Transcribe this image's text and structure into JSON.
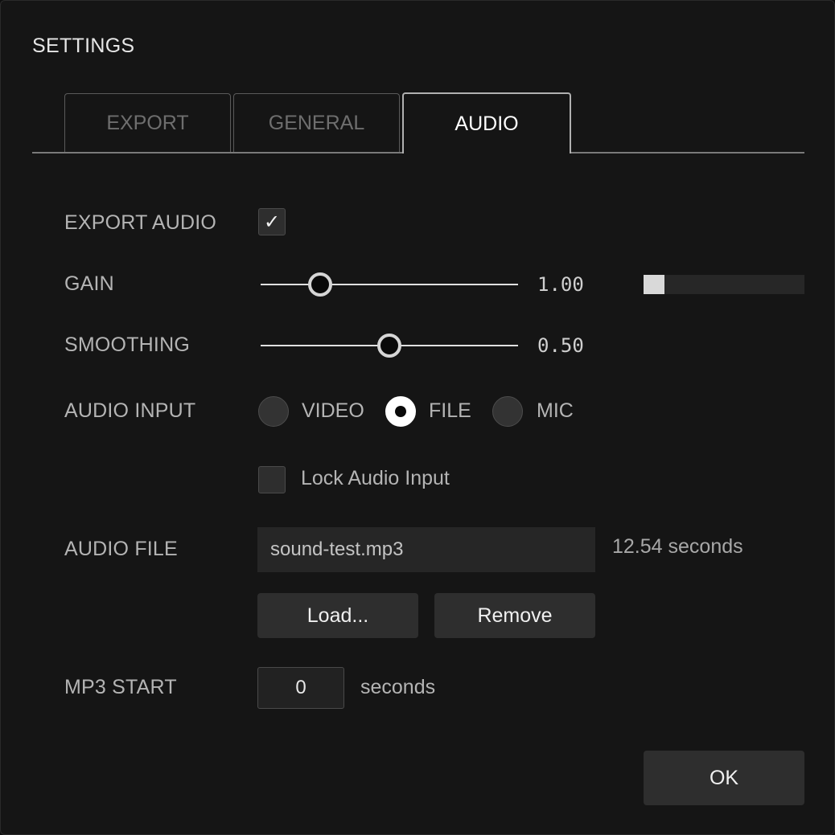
{
  "dialog": {
    "title": "SETTINGS"
  },
  "tabs": [
    {
      "label": "EXPORT",
      "active": false
    },
    {
      "label": "GENERAL",
      "active": false
    },
    {
      "label": "AUDIO",
      "active": true
    }
  ],
  "export_audio": {
    "label": "EXPORT AUDIO",
    "checked": true,
    "check_glyph": "✓"
  },
  "gain": {
    "label": "GAIN",
    "value_text": "1.00",
    "slider_fraction": 0.23,
    "level_fraction": 0.13
  },
  "smoothing": {
    "label": "SMOOTHING",
    "value_text": "0.50",
    "slider_fraction": 0.5
  },
  "audio_input": {
    "label": "AUDIO INPUT",
    "options": [
      {
        "label": "VIDEO",
        "selected": false
      },
      {
        "label": "FILE",
        "selected": true
      },
      {
        "label": "MIC",
        "selected": false
      }
    ]
  },
  "lock_audio_input": {
    "label": "Lock Audio Input",
    "checked": false
  },
  "audio_file": {
    "label": "AUDIO FILE",
    "filename": "sound-test.mp3",
    "duration_text": "12.54 seconds",
    "load_label": "Load...",
    "remove_label": "Remove"
  },
  "mp3_start": {
    "label": "MP3 START",
    "value": "0",
    "unit": "seconds"
  },
  "footer": {
    "ok_label": "OK"
  },
  "colors": {
    "background": "#151515",
    "text": "#b4b4b4",
    "accent": "#ffffff"
  }
}
